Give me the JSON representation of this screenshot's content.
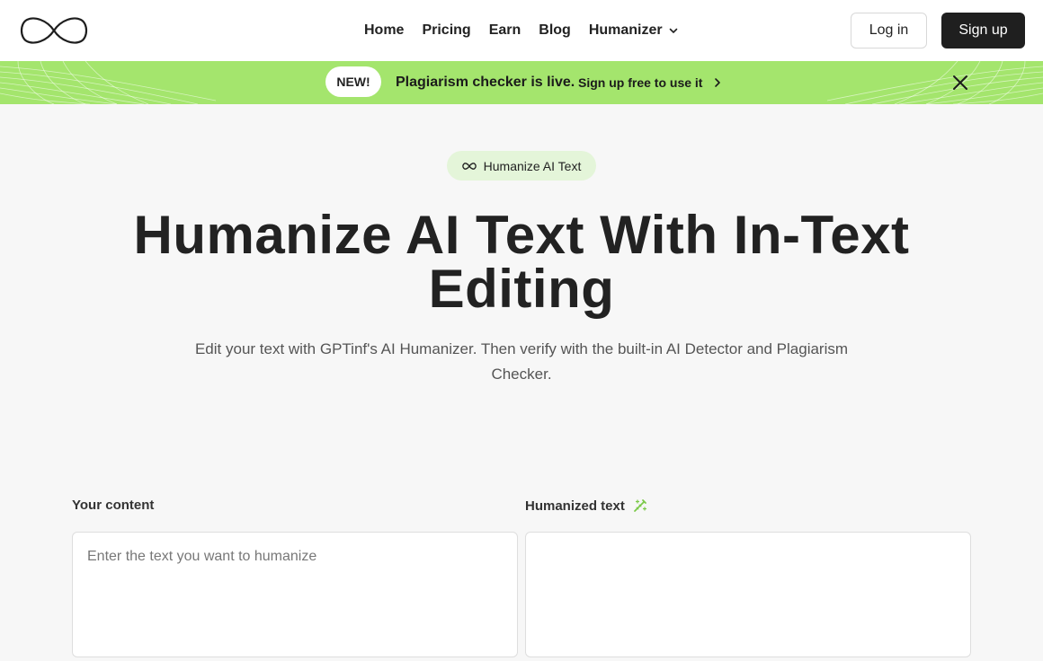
{
  "header": {
    "logo_icon": "infinity-logo-icon",
    "nav": [
      {
        "label": "Home"
      },
      {
        "label": "Pricing"
      },
      {
        "label": "Earn"
      },
      {
        "label": "Blog"
      },
      {
        "label": "Humanizer",
        "has_dropdown": true
      }
    ],
    "login_label": "Log in",
    "signup_label": "Sign up"
  },
  "banner": {
    "badge": "NEW!",
    "text": "Plagiarism checker is live.",
    "link": "Sign up free to use it",
    "bg_color": "#a4e56d",
    "close_icon": "close-icon"
  },
  "hero": {
    "pill_label": "Humanize AI Text",
    "title_line1": "Humanize AI Text With In-Text",
    "title_line2": "Editing",
    "subtitle": "Edit your text with GPTinf's AI Humanizer. Then verify with the built-in AI Detector and Plagiarism Checker."
  },
  "editor": {
    "input_label": "Your content",
    "input_placeholder": "Enter the text you want to humanize",
    "output_label": "Humanized text",
    "output_icon": "magic-wand-icon"
  }
}
